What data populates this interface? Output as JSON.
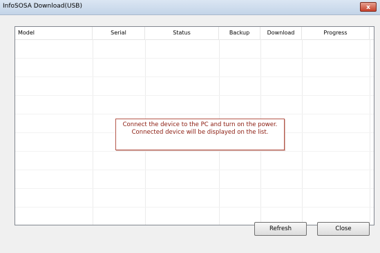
{
  "window": {
    "title": "InfoSOSA Download(USB)",
    "close_glyph": "x"
  },
  "list": {
    "columns": [
      "Model",
      "Serial",
      "Status",
      "Backup",
      "Download",
      "Progress"
    ],
    "rows": [],
    "empty_message": {
      "line1": "Connect the device to the PC and turn on the power.",
      "line2": "Connected device will be displayed on the list."
    }
  },
  "buttons": {
    "refresh": "Refresh",
    "close": "Close"
  }
}
